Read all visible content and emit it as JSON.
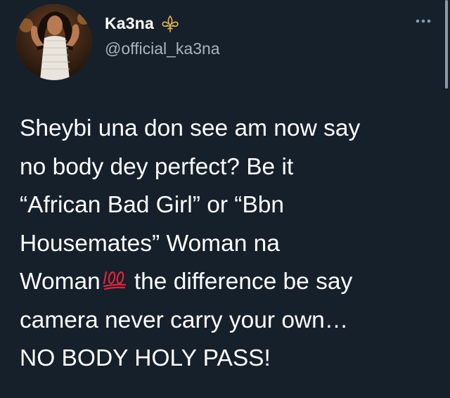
{
  "author": {
    "display_name": "Ka3na",
    "handle": "@official_ka3na",
    "avatar": "profile-photo",
    "badge_icon": "fleur-de-lis-icon"
  },
  "menu": {
    "icon": "more-options-icon"
  },
  "tweet": {
    "lines": [
      "Sheybi una don see am now say",
      "no body dey perfect? Be it",
      "“African Bad Girl” or “Bbn",
      "Housemates” Woman na",
      "Woman",
      "the difference be say",
      "camera never carry your own…",
      "NO BODY HOLY PASS!"
    ],
    "emoji": "hundred-points-emoji"
  },
  "colors": {
    "background": "#15202b",
    "text": "#ffffff",
    "secondary_text": "#a9b4bd",
    "emoji_red": "#e0243a",
    "badge_gold": "#e6b84a"
  }
}
